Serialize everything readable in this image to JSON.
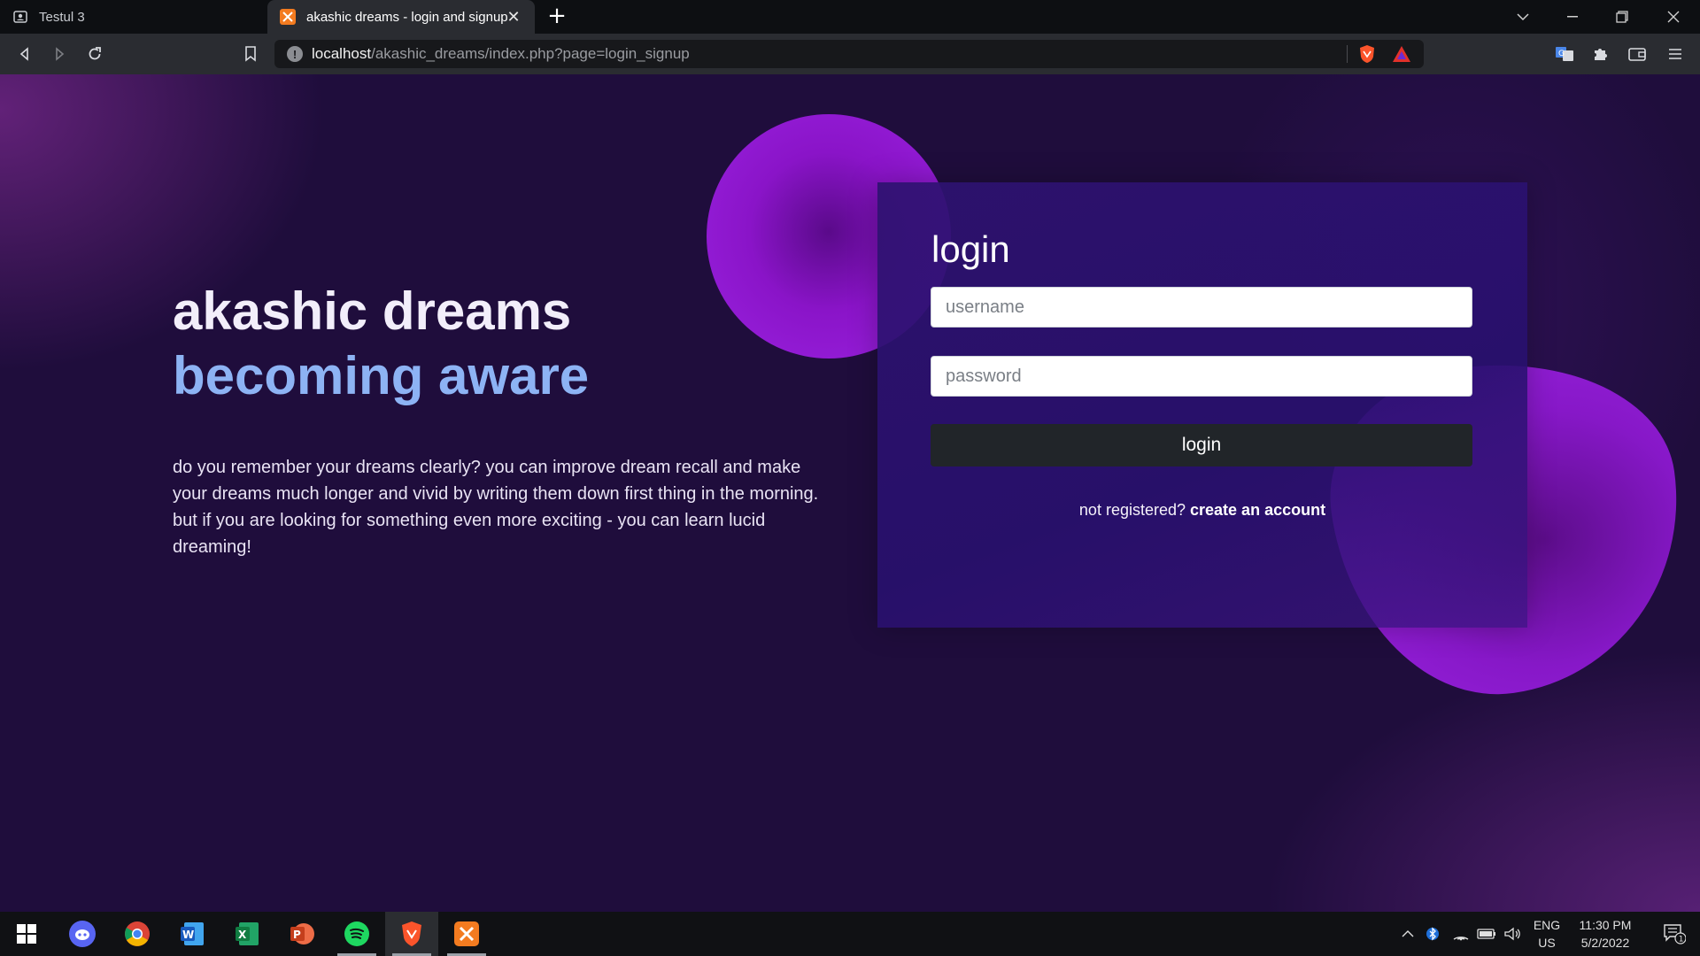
{
  "browser": {
    "tabs": [
      {
        "label": "Testul 3",
        "active": false,
        "icon": "person-icon"
      },
      {
        "label": "akashic dreams - login and signup",
        "active": true,
        "icon": "xampp-icon"
      }
    ],
    "url_host": "localhost",
    "url_path": "/akashic_dreams/index.php?page=login_signup"
  },
  "hero": {
    "title": "akashic dreams",
    "subtitle": "becoming aware",
    "text": "do you remember your dreams clearly? you can improve dream recall and make your dreams much longer and vivid by writing them down first thing in the morning. but if you are looking for something even more exciting - you can learn lucid dreaming!"
  },
  "login": {
    "heading": "login",
    "username_placeholder": "username",
    "password_placeholder": "password",
    "button_label": "login",
    "register_prompt": "not registered?",
    "register_link": "create an account"
  },
  "taskbar": {
    "apps": [
      "windows-start-icon",
      "discord-icon",
      "chrome-icon",
      "word-icon",
      "excel-icon",
      "powerpoint-icon",
      "spotify-icon",
      "brave-icon",
      "xampp-icon"
    ],
    "lang_line1": "ENG",
    "lang_line2": "US",
    "time": "11:30 PM",
    "date": "5/2/2022",
    "notification_count": "1"
  },
  "colors": {
    "background": "#1f0d3c",
    "accent_purple": "#9a22e0",
    "subtitle_blue": "#8db3f4",
    "button_dark": "#212529"
  }
}
